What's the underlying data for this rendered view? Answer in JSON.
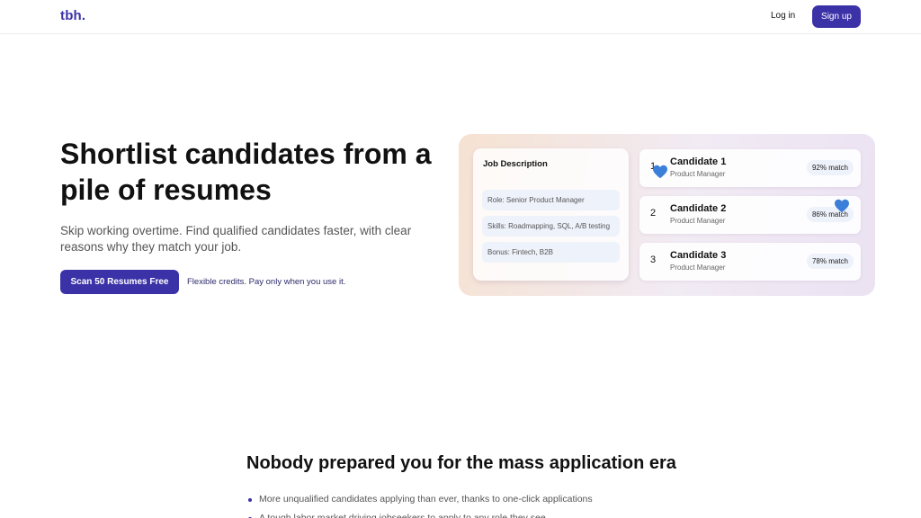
{
  "nav": {
    "logo": "tbh.",
    "login_label": "Log in",
    "signup_label": "Sign up"
  },
  "hero": {
    "title": "Shortlist candidates from a pile of resumes",
    "subtitle": "Skip working overtime. Find qualified candidates faster, with clear reasons why they match your job.",
    "cta_label": "Scan 50 Resumes Free",
    "cta_note": "Flexible credits. Pay only when you use it."
  },
  "demo": {
    "job_description": {
      "title": "Job Description",
      "items": [
        "Role: Senior Product Manager",
        "Skills: Roadmapping, SQL, A/B testing",
        "Bonus: Fintech, B2B"
      ]
    },
    "candidates": [
      {
        "rank": "1",
        "name": "Candidate 1",
        "role": "Product Manager",
        "match": "92% match"
      },
      {
        "rank": "2",
        "name": "Candidate 2",
        "role": "Product Manager",
        "match": "86% match"
      },
      {
        "rank": "3",
        "name": "Candidate 3",
        "role": "Product Manager",
        "match": "78% match"
      }
    ],
    "heart_icon": "blue-heart-icon",
    "heart_color": "#3b7fd8"
  },
  "section": {
    "title": "Nobody prepared you for the mass application era",
    "bullets": [
      "More unqualified candidates applying than ever, thanks to one-click applications",
      "A tough labor market driving jobseekers to apply to any role they see"
    ]
  },
  "colors": {
    "brand": "#3b32a8"
  }
}
